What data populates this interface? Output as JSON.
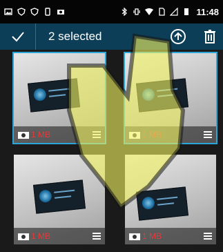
{
  "status_bar": {
    "time": "11:48",
    "left_icons": [
      "gallery-icon",
      "shield-icon",
      "shield-icon",
      "phone-icon",
      "camera-icon"
    ],
    "right_icons": [
      "bluetooth-icon",
      "vibrate-icon",
      "wifi-icon",
      "sim-icon",
      "signal-icon",
      "battery-icon"
    ]
  },
  "action_bar": {
    "selected_label": "2 selected",
    "background": "#0c3f57"
  },
  "photos": [
    {
      "size": "1 MB",
      "selected": true
    },
    {
      "size": "1 MB",
      "selected": true
    },
    {
      "size": "1 MB",
      "selected": false
    },
    {
      "size": "1 MB",
      "selected": false
    }
  ],
  "colors": {
    "accent": "#2aa6d8",
    "size_text": "#e33b3b",
    "overlay": "#f0f060"
  }
}
